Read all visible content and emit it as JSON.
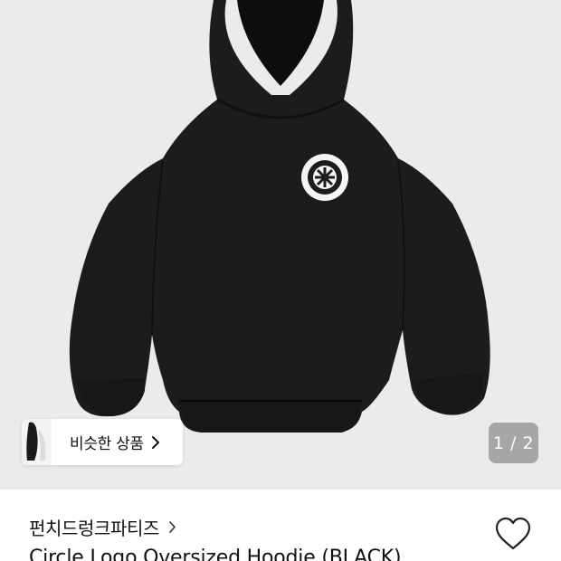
{
  "product_image": {
    "alt": "Black oversized hoodie with white circle logo",
    "counter": "1 / 2"
  },
  "similar": {
    "label": "비슷한 상품"
  },
  "brand": {
    "name": "펀치드렁크파티즈"
  },
  "product": {
    "title": "Circle Logo Oversized Hoodie (BLACK)"
  },
  "icons": {
    "similar_chevron": "chevron-right-icon",
    "brand_chevron": "chevron-right-icon",
    "wish": "heart-outline-icon"
  },
  "colors": {
    "image_background": "#ebebeb",
    "hoodie": "#1c1c1c",
    "text": "#111111",
    "counter_background": "#6e6e6e"
  }
}
